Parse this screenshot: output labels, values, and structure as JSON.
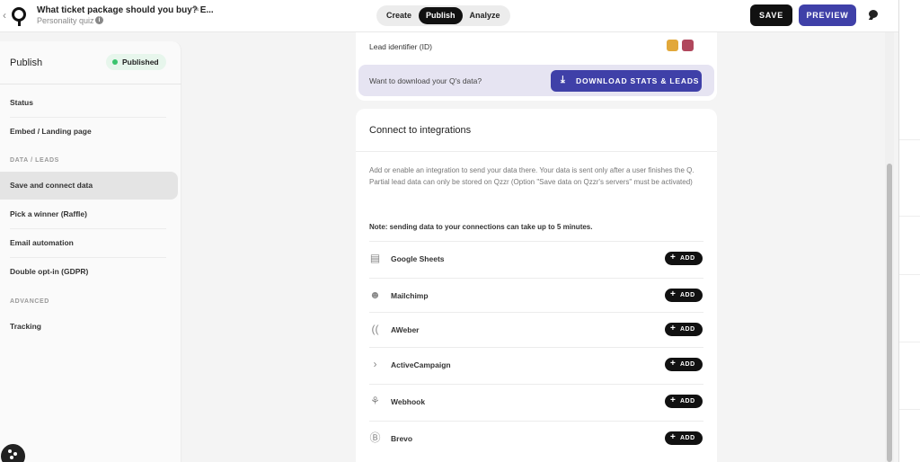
{
  "header": {
    "quiz_title": "What ticket package should you buy? E...",
    "quiz_type": "Personality quiz",
    "tabs": [
      {
        "label": "Create"
      },
      {
        "label": "Publish"
      },
      {
        "label": "Analyze"
      }
    ],
    "save_label": "SAVE",
    "preview_label": "PREVIEW"
  },
  "sidebar": {
    "title": "Publish",
    "status_badge": "Published",
    "items": [
      {
        "label": "Status"
      },
      {
        "label": "Embed / Landing page"
      },
      {
        "label": "Save and connect data"
      },
      {
        "label": "Pick a winner (Raffle)"
      },
      {
        "label": "Email automation"
      },
      {
        "label": "Double opt-in (GDPR)"
      },
      {
        "label": "Tracking"
      }
    ],
    "sections": {
      "data_leads": "DATA / LEADS",
      "advanced": "ADVANCED"
    }
  },
  "data_card": {
    "lead_identifier": "Lead identifier (ID)",
    "download_prompt": "Want to download your Q's data?",
    "download_button": "DOWNLOAD STATS & LEADS"
  },
  "integrations": {
    "title": "Connect to integrations",
    "description": "Add or enable an integration to send your data there. Your data is sent only after a user finishes the Q. Partial lead data can only be stored on Qzzr (Option \"Save data on Qzzr's servers\" must be activated)",
    "note": "Note: sending data to your connections can take up to 5 minutes.",
    "add_label": "ADD",
    "items": [
      {
        "name": "Google Sheets",
        "icon": "google-sheets-icon"
      },
      {
        "name": "Mailchimp",
        "icon": "mailchimp-icon"
      },
      {
        "name": "AWeber",
        "icon": "aweber-icon"
      },
      {
        "name": "ActiveCampaign",
        "icon": "activecampaign-icon"
      },
      {
        "name": "Webhook",
        "icon": "webhook-icon"
      },
      {
        "name": "Brevo",
        "icon": "brevo-icon"
      }
    ]
  },
  "colors": {
    "primary": "#3f40a8",
    "published_green": "#3ac46d",
    "dark": "#111111"
  }
}
